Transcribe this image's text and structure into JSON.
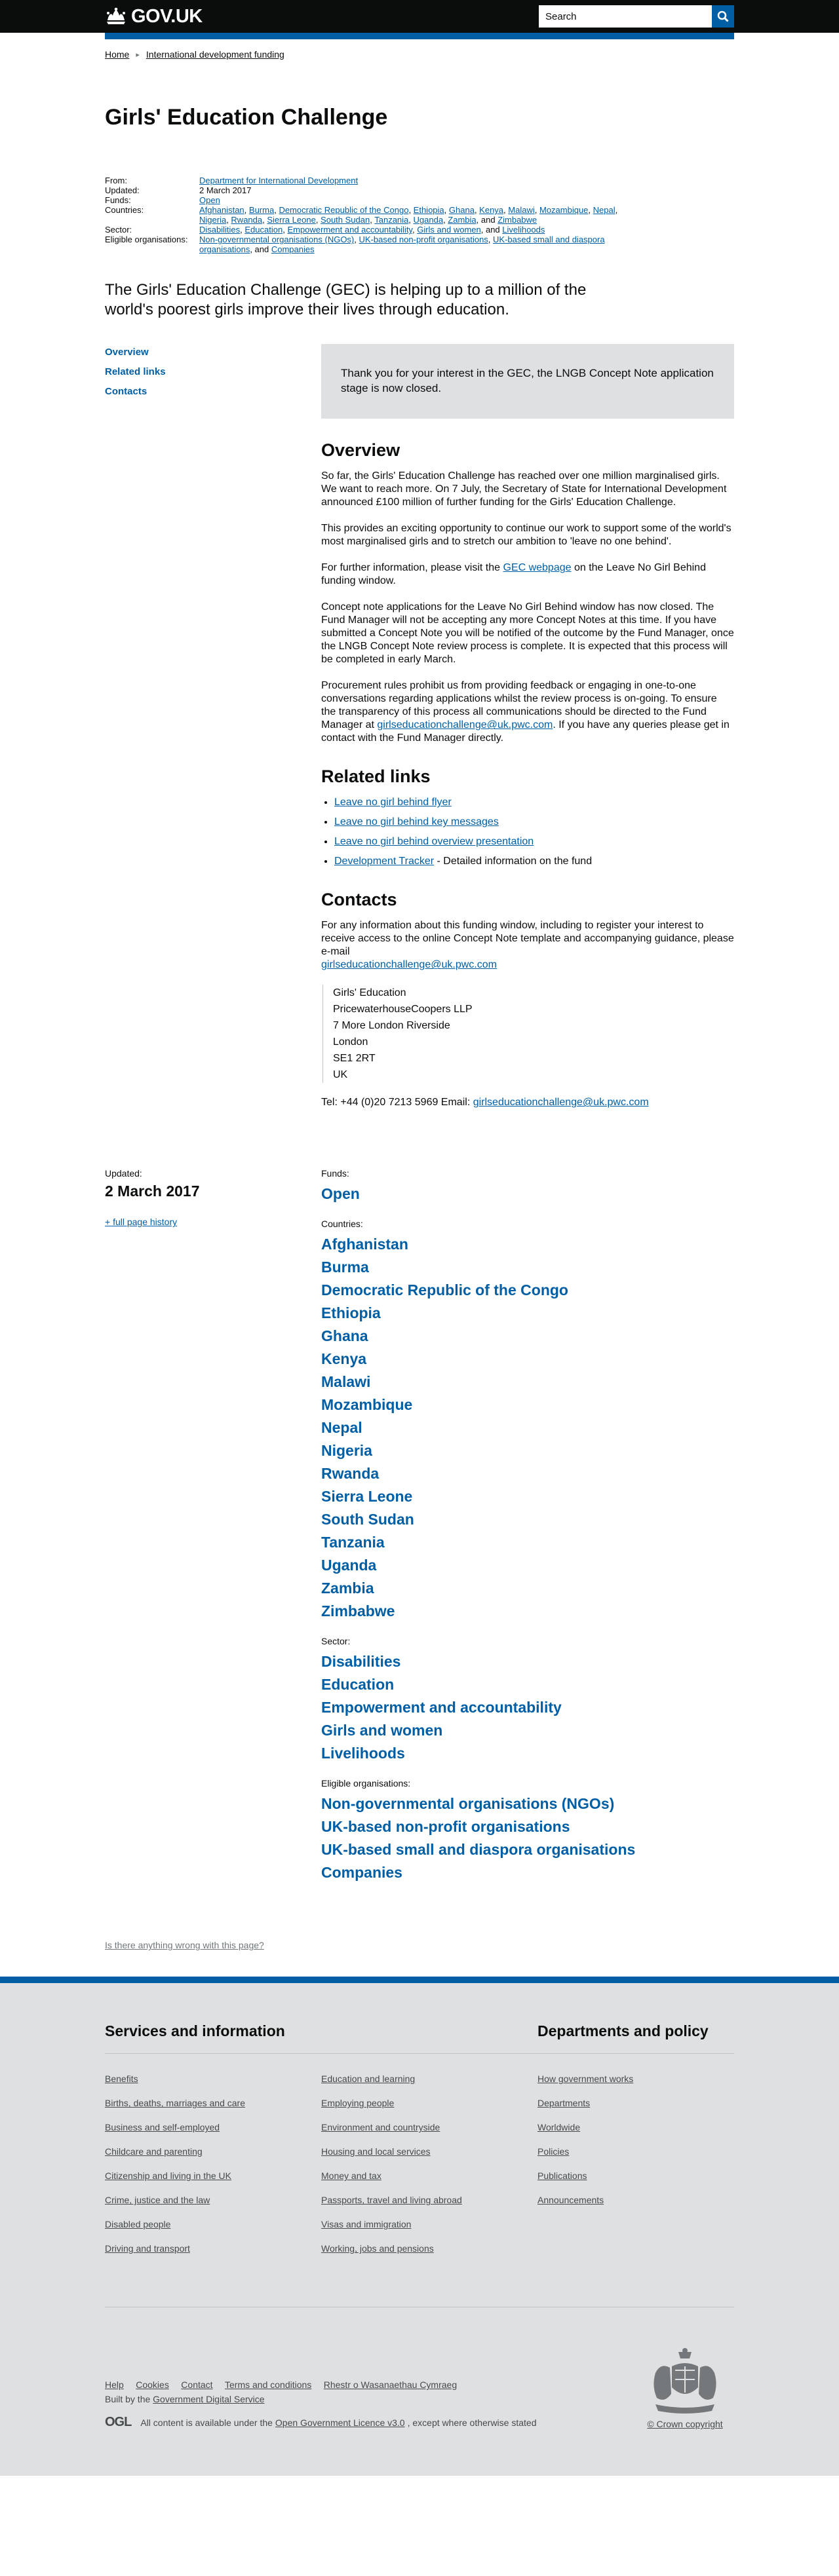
{
  "header": {
    "logo_text": "GOV.UK",
    "search_placeholder": "Search",
    "accent": "#005ea5"
  },
  "breadcrumb": [
    "Home",
    "International development funding"
  ],
  "title": "Girls' Education Challenge",
  "metadata": {
    "from_label": "From:",
    "from_value": "Department for International Development",
    "updated_label": "Updated:",
    "updated_value": "2 March 2017",
    "funds_label": "Funds:",
    "funds_value": "Open",
    "countries_label": "Countries:",
    "countries": [
      "Afghanistan",
      "Burma",
      "Democratic Republic of the Congo",
      "Ethiopia",
      "Ghana",
      "Kenya",
      "Malawi",
      "Mozambique",
      "Nepal",
      "Nigeria",
      "Rwanda",
      "Sierra Leone",
      "South Sudan",
      "Tanzania",
      "Uganda",
      "Zambia",
      "Zimbabwe"
    ],
    "sector_label": "Sector:",
    "sectors": [
      "Disabilities",
      "Education",
      "Empowerment and accountability",
      "Girls and women",
      "Livelihoods"
    ],
    "eligible_label": "Eligible organisations:",
    "eligible": [
      "Non-governmental organisations (NGOs)",
      "UK-based non-profit organisations",
      "UK-based small and diaspora organisations",
      "Companies"
    ],
    "and_word": "and"
  },
  "lede": "The Girls' Education Challenge (GEC) is helping up to a million of the world's poorest girls improve their lives through education.",
  "sidenav": [
    "Overview",
    "Related links",
    "Contacts"
  ],
  "callout": "Thank you for your interest in the GEC, the LNGB Concept Note application stage is now closed.",
  "overview": {
    "heading": "Overview",
    "p1": "So far, the Girls' Education Challenge has reached over one million marginalised girls. We want to reach more. On 7 July, the Secretary of State for International Development announced £100 million of further funding for the Girls' Education Challenge.",
    "p2": "This provides an exciting opportunity to continue our work to support some of the world's most marginalised girls and to stretch our ambition to 'leave no one behind'.",
    "p3_before": "For further information, please visit the ",
    "p3_link": "GEC webpage",
    "p3_after": " on the Leave No Girl Behind funding window.",
    "p4": "Concept note applications for the Leave No Girl Behind window has now closed. The Fund Manager will not be accepting any more Concept Notes at this time. If you have submitted a Concept Note you will be notified of the outcome by the Fund Manager, once the LNGB Concept Note review process is complete. It is expected that this process will be completed in early March.",
    "p5_before": "Procurement rules prohibit us from providing feedback or engaging in one-to-one conversations regarding applications whilst the review process is on-going. To ensure the transparency of this process all communications should be directed to the Fund Manager at ",
    "p5_link": "girlseducationchallenge@uk.pwc.com",
    "p5_after": ". If you have any queries please get in contact with the Fund Manager directly."
  },
  "related": {
    "heading": "Related links",
    "links": [
      "Leave no girl behind flyer",
      "Leave no girl behind key messages",
      "Leave no girl behind overview presentation",
      "Development Tracker"
    ],
    "tracker_suffix": " - Detailed information on the fund"
  },
  "contacts": {
    "heading": "Contacts",
    "intro": "For any information about this funding window, including to register your interest to receive access to the online Concept Note template and accompanying guidance, please e-mail",
    "email": "girlseducationchallenge@uk.pwc.com",
    "address": [
      "Girls' Education",
      "PricewaterhouseCoopers LLP",
      "7 More London Riverside",
      "London",
      "SE1 2RT",
      "UK"
    ],
    "tel_text": "Tel: +44 (0)20 7213 5969 Email: "
  },
  "lower": {
    "updated_label": "Updated:",
    "updated_value": "2 March 2017",
    "history_link": "+ full page history",
    "funds_label": "Funds:",
    "funds": [
      "Open"
    ],
    "countries_label": "Countries:",
    "sector_label": "Sector:",
    "eligible_label": "Eligible organisations:"
  },
  "report_link": "Is there anything wrong with this page?",
  "footer": {
    "services_heading": "Services and information",
    "services_col1": [
      "Benefits",
      "Births, deaths, marriages and care",
      "Business and self-employed",
      "Childcare and parenting",
      "Citizenship and living in the UK",
      "Crime, justice and the law",
      "Disabled people",
      "Driving and transport"
    ],
    "services_col2": [
      "Education and learning",
      "Employing people",
      "Environment and countryside",
      "Housing and local services",
      "Money and tax",
      "Passports, travel and living abroad",
      "Visas and immigration",
      "Working, jobs and pensions"
    ],
    "depts_heading": "Departments and policy",
    "depts": [
      "How government works",
      "Departments",
      "Worldwide",
      "Policies",
      "Publications",
      "Announcements"
    ],
    "meta_links": [
      "Help",
      "Cookies",
      "Contact",
      "Terms and conditions",
      "Rhestr o Wasanaethau Cymraeg"
    ],
    "built_by_prefix": "Built by the ",
    "built_by_link": "Government Digital Service",
    "ogl": "OGL",
    "licence_prefix": "All content is available under the",
    "licence_link": "Open Government Licence v3.0",
    "licence_suffix": ", except where otherwise stated",
    "copyright": "© Crown copyright"
  }
}
